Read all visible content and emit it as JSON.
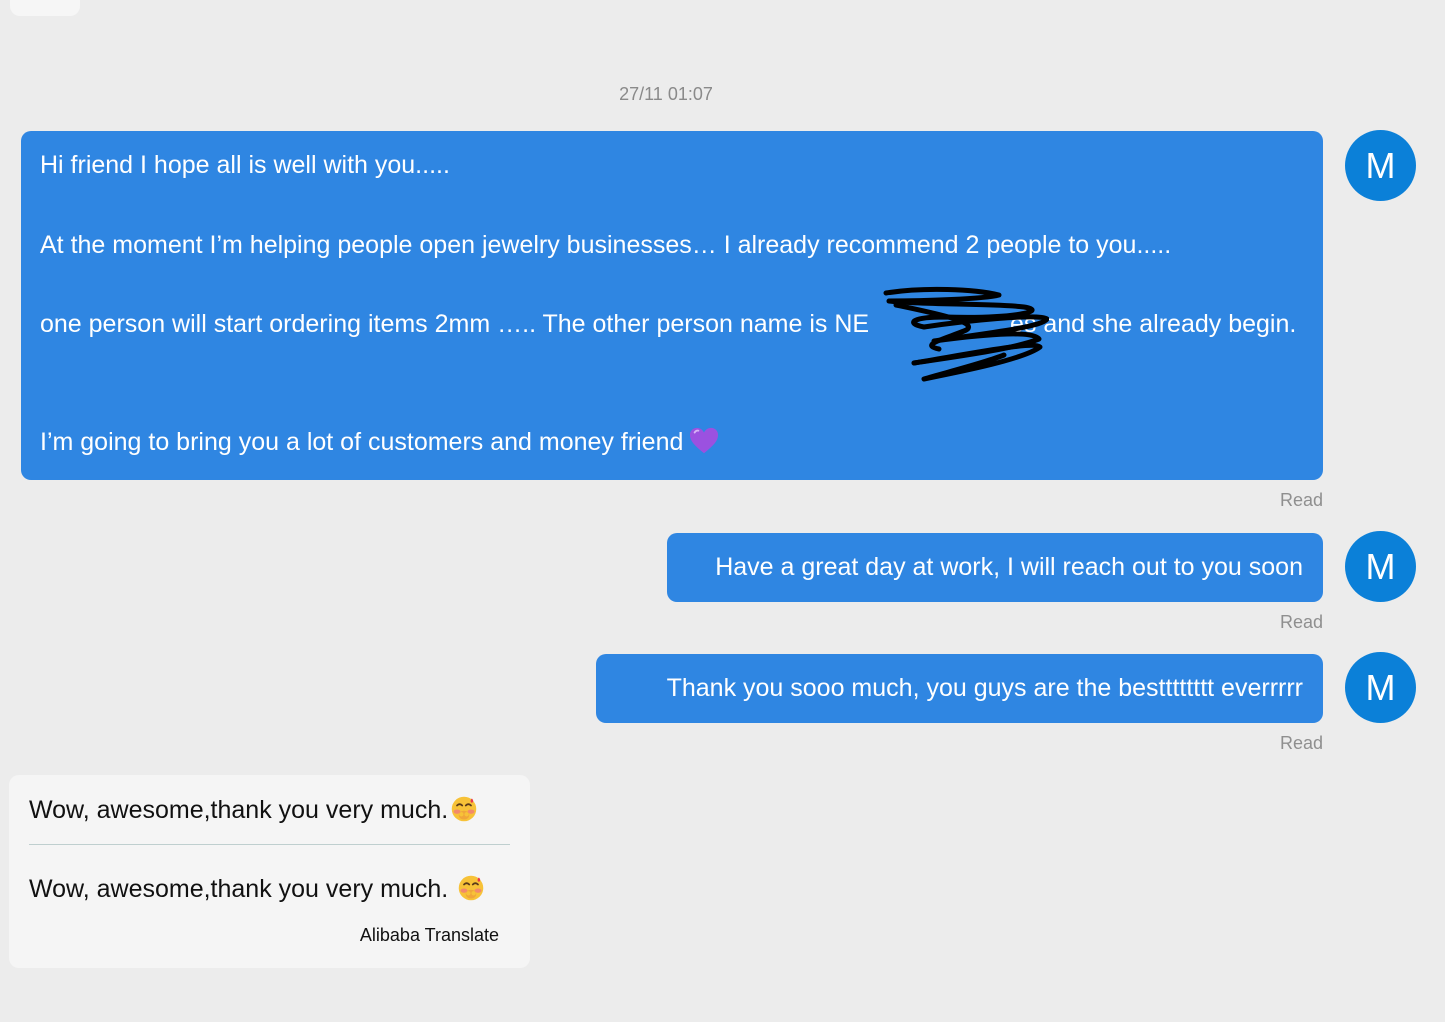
{
  "timestamp": "27/11 01:07",
  "messages": [
    {
      "lines": [
        "Hi friend I hope all is well with you.....",
        "At the moment I’m helping people open jewelry businesses… I already recommend 2 people to you.....",
        "one person will start ordering items  2mm ….. The other person name is NE",
        "es and she already begin.",
        "I’m going to bring you a lot of customers and money friend"
      ],
      "emoji": "purple-heart",
      "avatar": "M",
      "status": "Read"
    },
    {
      "text": "Have a great day at work, I will reach out to you soon",
      "avatar": "M",
      "status": "Read"
    },
    {
      "text": "Thank you sooo much, you guys are the bestttttttt everrrrr",
      "avatar": "M",
      "status": "Read"
    }
  ],
  "incoming": {
    "original": "Wow, awesome,thank you very much.",
    "translated": "Wow, awesome,thank you very much. ",
    "emoji": "face-holding-back-tears",
    "translate_label": "Alibaba Translate"
  },
  "colors": {
    "bubble": "#2f86e2",
    "avatar": "#0b80d8",
    "background": "#ececec",
    "incoming_bubble": "#f5f5f5"
  }
}
